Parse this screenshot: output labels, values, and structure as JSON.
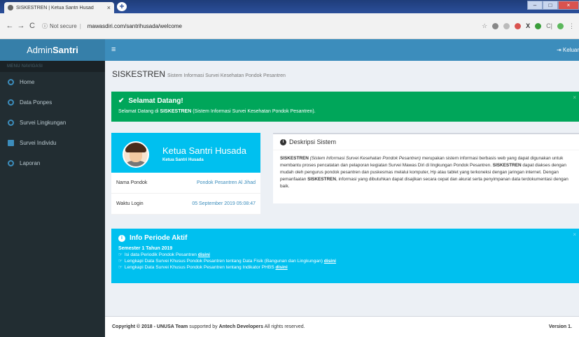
{
  "browser": {
    "tab_title": "SISKESTREN | Ketua Santri Husad",
    "not_secure": "Not secure",
    "url": "mawasdiri.com/santrihusada/welcome"
  },
  "app": {
    "logo_prefix": "Admin",
    "logo_bold": "Santri",
    "logout_label": "Keluar"
  },
  "sidebar": {
    "header": "MENU NAVIGASI",
    "items": [
      {
        "label": "Home"
      },
      {
        "label": "Data Ponpes"
      },
      {
        "label": "Survei Lingkungan"
      },
      {
        "label": "Survei Individu"
      },
      {
        "label": "Laporan"
      }
    ]
  },
  "page": {
    "title": "SISKESTREN",
    "subtitle": "Sistem Informasi Survei Kesehatan Pondok Pesantren"
  },
  "welcome": {
    "title": "Selamat Datang!",
    "message_prefix": "Selamat Datang di ",
    "message_bold": "SISKESTREN",
    "message_suffix": " (Sistem Informasi Survei Kesehatan Pondok Pesantren)."
  },
  "profile": {
    "name": "Ketua Santri Husada",
    "role": "Ketua Santri Husada",
    "rows": [
      {
        "label": "Nama Pondok",
        "value": "Pondok Pesantren Al Jihad"
      },
      {
        "label": "Waktu Login",
        "value": "05 September 2019 05:08:47"
      }
    ]
  },
  "description": {
    "title": "Deskripsi Sistem",
    "p1_bold": "SISKESTREN",
    "p1_italic": "(Sistem Informasi Survei Kesehatan Pondok Pesantren)",
    "p1_rest": " merupakan sistem informasi berbasis web yang dapat digunakan untuk membantu proses pencatatan dan pelaporan kegiatan Survei Mawas Diri di lingkungan Pondok Pesantren. ",
    "p2_bold": "SISKESTREN",
    "p2_rest": " dapat diakses dengan mudah oleh pengurus pondok pesantren dan puskesmas melalui komputer, Hp atau tablet yang terkoneksi dengan jaringan internet. Dengan pemanfaatan ",
    "p3_bold": "SISKESTREN",
    "p3_rest": ", informasi yang dibutuhkan dapat disajikan secara cepat dan akurat serta penyimpanan data terdokumentasi dengan baik."
  },
  "period": {
    "title": "Info Periode Aktif",
    "semester": "Semester 1 Tahun 2019",
    "lines": [
      {
        "text": "Isi data Periodik Pondok Pesantren ",
        "link": "disini"
      },
      {
        "text": "Lengkapi Data Survei Khusus Pondok Pesantren tentang Data Fisik (Bangunan dan Lingkungan) ",
        "link": "disini"
      },
      {
        "text": "Lengkapi Data Survei Khusus Pondok Pesantren tentang Indikator PHBS ",
        "link": "disini"
      }
    ]
  },
  "footer": {
    "copyright_prefix": "Copyright © 2018 - ",
    "team": "UNUSA Team",
    "supported": " supported by ",
    "dev": "Antech Developers",
    "rights": " All rights reserved.",
    "version": "Version 1."
  },
  "colors": {
    "primary": "#3c8dbc",
    "success": "#00a65a",
    "info": "#00c0ef",
    "sidebar": "#222d32"
  }
}
